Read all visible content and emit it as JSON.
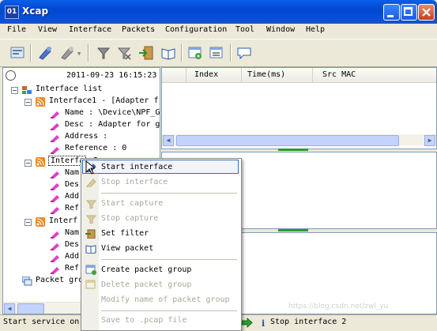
{
  "window": {
    "title": "Xcap",
    "app_icon_label": "01"
  },
  "menu": [
    "File",
    "View",
    "Interface",
    "Packets",
    "Configuration",
    "Tool",
    "Window",
    "Help"
  ],
  "toolbar": {
    "icons": [
      "interfaces-icon",
      "start-capture-icon",
      "stop-capture-icon",
      "filter-icon",
      "filter-off-icon",
      "export-icon",
      "book-icon",
      "create-group-icon",
      "group-list-icon",
      "chat-icon"
    ]
  },
  "left_panel": {
    "date": "2011-09-23 16:15:23",
    "tree": [
      {
        "text": "Interface list"
      },
      {
        "text": "Interface1 - [Adapter f"
      },
      {
        "text": "Name : \\Device\\NPF_G"
      },
      {
        "text": "Desc : Adapter for g"
      },
      {
        "text": "Address :"
      },
      {
        "text": "Reference : 0"
      },
      {
        "text": "Interface2"
      },
      {
        "text": "Nam"
      },
      {
        "text": "Des"
      },
      {
        "text": "Add"
      },
      {
        "text": "Ref"
      },
      {
        "text": "Interf"
      },
      {
        "text": "Nam"
      },
      {
        "text": "Des"
      },
      {
        "text": "Add"
      },
      {
        "text": "Ref"
      },
      {
        "text": "Packet gro"
      }
    ]
  },
  "packet_table": {
    "columns": [
      "Index",
      "Time(ms)",
      "Src MAC"
    ]
  },
  "context_menu": {
    "items": [
      {
        "label": "Start interface",
        "enabled": true
      },
      {
        "label": "Stop interface",
        "enabled": false
      },
      {
        "label": "Start capture",
        "enabled": false
      },
      {
        "label": "Stop capture",
        "enabled": false
      },
      {
        "label": "Set filter",
        "enabled": true
      },
      {
        "label": "View packet",
        "enabled": true
      },
      {
        "label": "Create packet group",
        "enabled": true
      },
      {
        "label": "Delete packet group",
        "enabled": false
      },
      {
        "label": "Modify name of packet group",
        "enabled": false
      },
      {
        "label": "Save to .pcap file",
        "enabled": false
      }
    ]
  },
  "status": {
    "left": "Start service on",
    "right": "Stop interface 2"
  },
  "watermark": "https://blog.csdn.net/zwl_yu"
}
